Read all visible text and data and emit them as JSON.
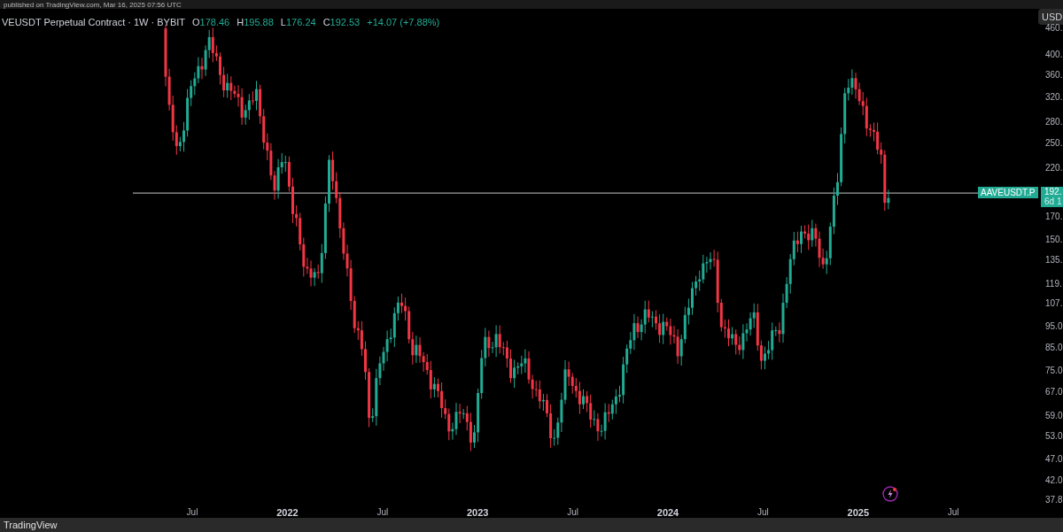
{
  "top_bar": {
    "text": "published on TradingView.com, Mar 16, 2025 07:56 UTC"
  },
  "legend": {
    "title": "VEUSDT Perpetual Contract · 1W · BYBIT",
    "values": [
      {
        "label": "O",
        "value": "178.46"
      },
      {
        "label": "H",
        "value": "195.88"
      },
      {
        "label": "L",
        "value": "176.24"
      },
      {
        "label": "C",
        "value": "192.53"
      }
    ],
    "change": "+14.07 (+7.88%)"
  },
  "currency_button": "USD",
  "price_axis": [
    "460.",
    "400.",
    "360.",
    "320.",
    "280.",
    "250.",
    "220.",
    "170.",
    "150.",
    "135.",
    "119.",
    "107.",
    "95.0",
    "85.0",
    "75.0",
    "67.0",
    "59.0",
    "53.0",
    "47.0",
    "42.0",
    "37.8"
  ],
  "price_marker": {
    "symbol": "AAVEUSDT.P",
    "price": "192.",
    "countdown": "6d 1"
  },
  "time_axis": [
    {
      "label": "Jul",
      "kind": "month"
    },
    {
      "label": "2022",
      "kind": "year"
    },
    {
      "label": "Jul",
      "kind": "month"
    },
    {
      "label": "2023",
      "kind": "year"
    },
    {
      "label": "Jul",
      "kind": "month"
    },
    {
      "label": "2024",
      "kind": "year"
    },
    {
      "label": "Jul",
      "kind": "month"
    },
    {
      "label": "2025",
      "kind": "year"
    },
    {
      "label": "Jul",
      "kind": "month"
    }
  ],
  "footer": {
    "text": "TradingView"
  }
}
